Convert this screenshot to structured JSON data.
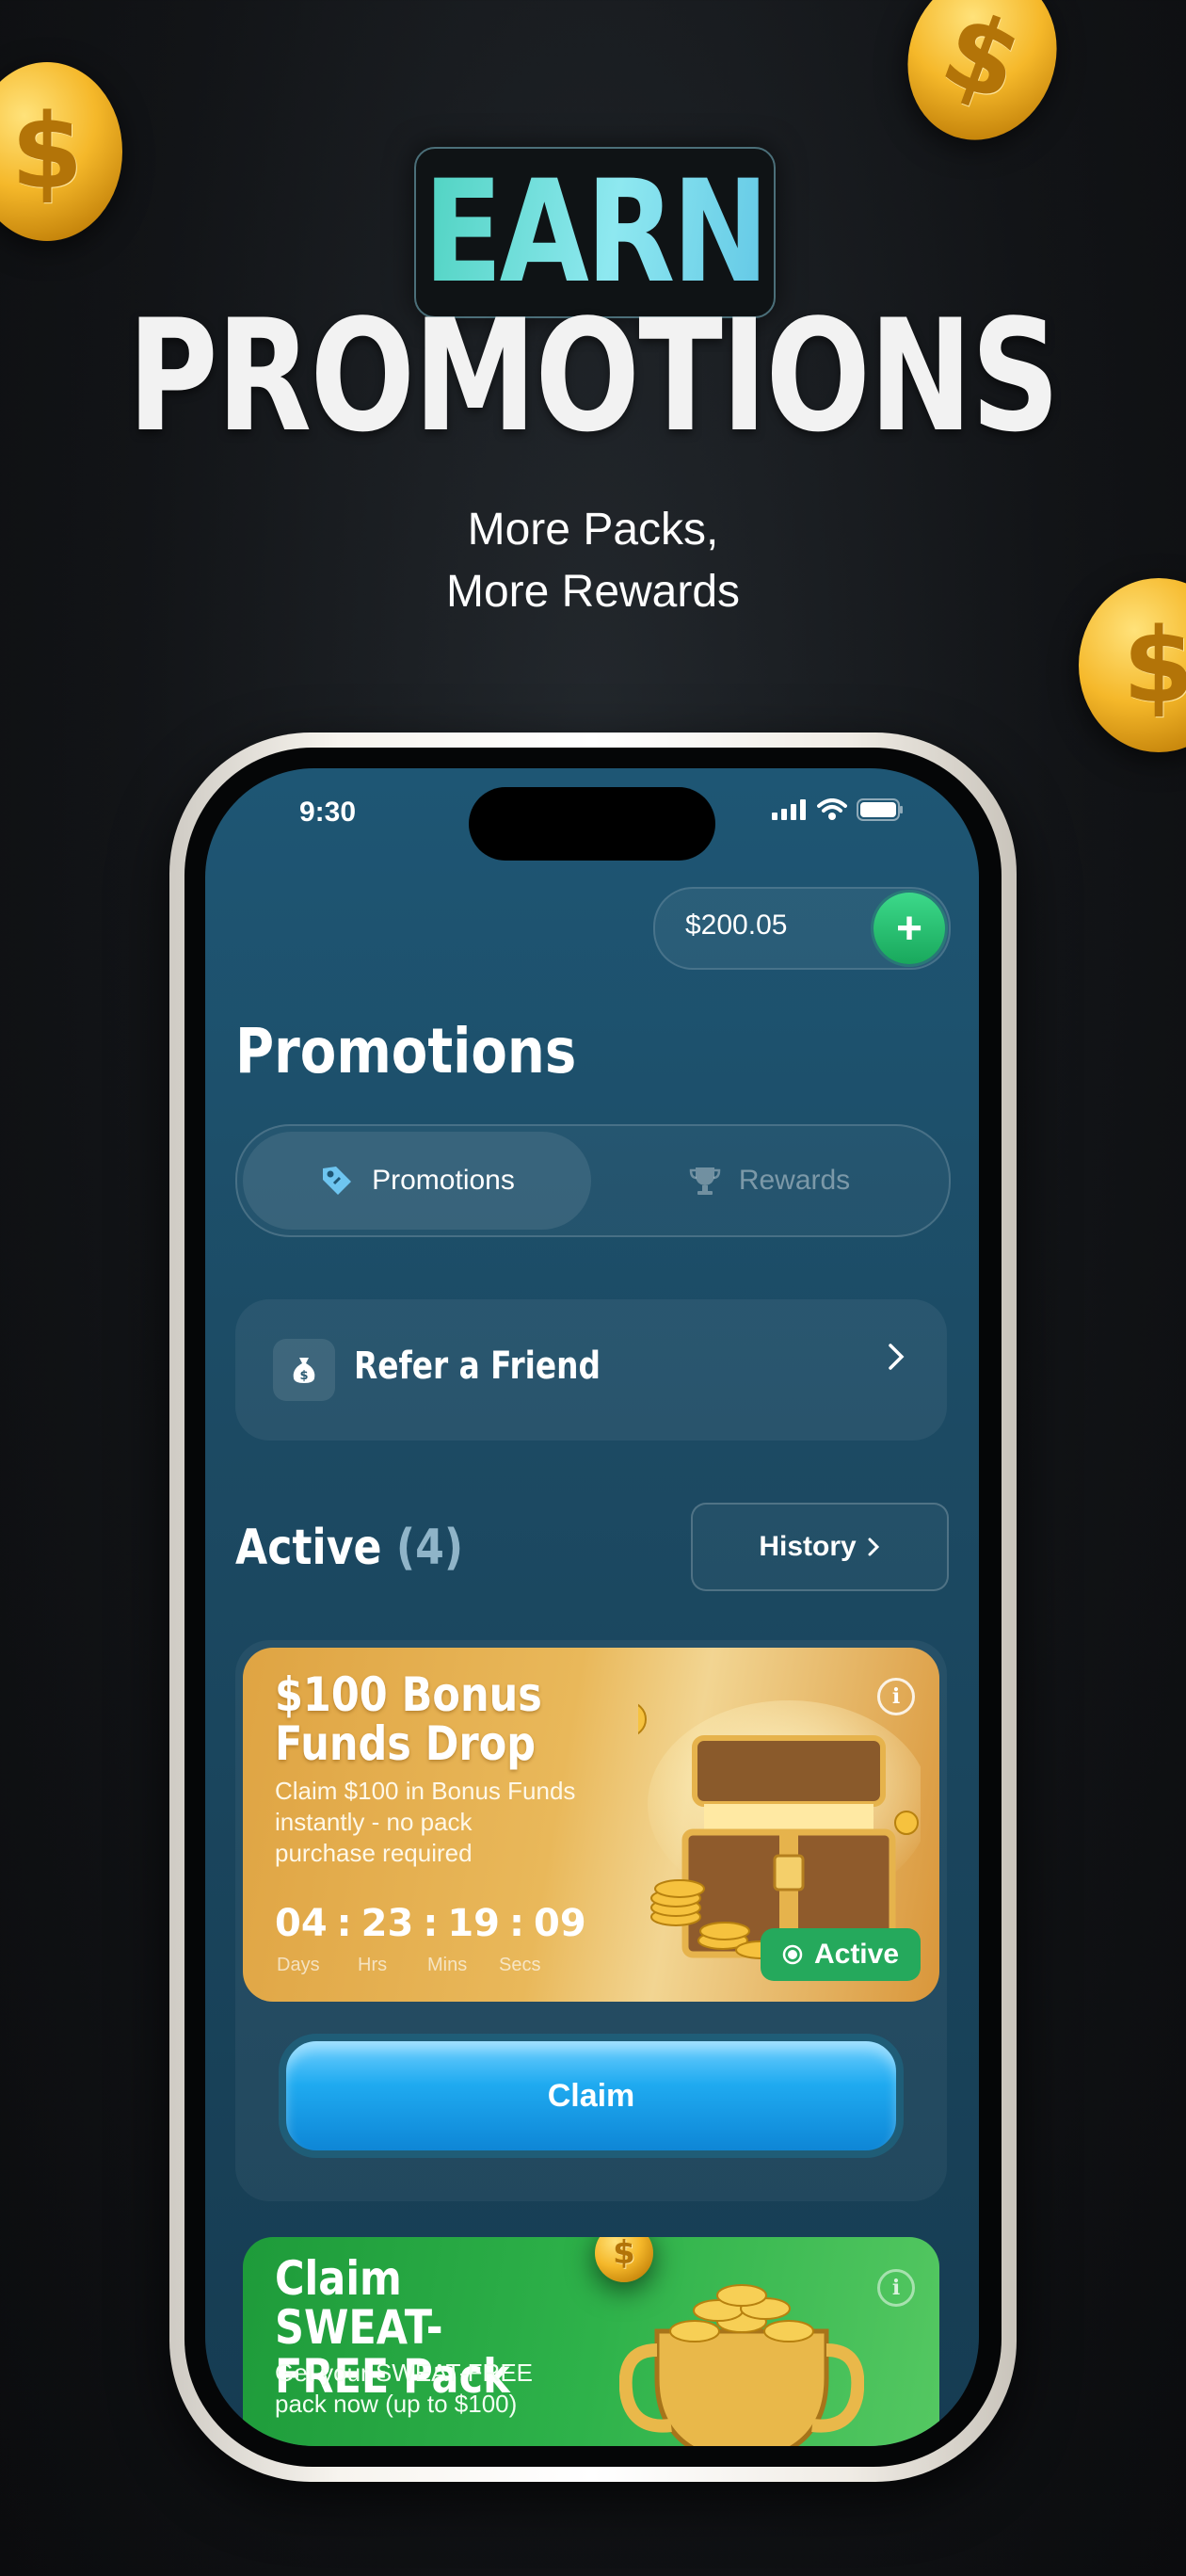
{
  "hero": {
    "earn": "EARN",
    "title": "PROMOTIONS",
    "subtitle_line1": "More Packs,",
    "subtitle_line2": "More Rewards"
  },
  "status_bar": {
    "time": "9:30"
  },
  "wallet": {
    "balance": "$200.05",
    "add_symbol": "+"
  },
  "page": {
    "title": "Promotions"
  },
  "tabs": [
    {
      "label": "Promotions",
      "icon": "tag-icon",
      "selected": true
    },
    {
      "label": "Rewards",
      "icon": "trophy-icon",
      "selected": false
    }
  ],
  "refer": {
    "label": "Refer a Friend",
    "icon": "money-bag-icon"
  },
  "active_section": {
    "title": "Active",
    "count": "(4)",
    "history_label": "History"
  },
  "promos": [
    {
      "title": "$100 Bonus Funds Drop",
      "description": "Claim $100 in Bonus Funds instantly - no pack purchase required",
      "timer": {
        "days": "04",
        "hours": "23",
        "mins": "19",
        "secs": "09"
      },
      "timer_labels": {
        "days": "Days",
        "hours": "Hrs",
        "mins": "Mins",
        "secs": "Secs"
      },
      "status": "Active",
      "cta": "Claim",
      "color": "#e3a848"
    },
    {
      "title": "Claim SWEAT-FREE Pack",
      "description": "Get your SWEAT-FREE pack now (up to $100)",
      "color": "#2eb24a"
    }
  ],
  "colors": {
    "accent_green": "#25a95c",
    "claim_blue": "#1faaf0",
    "screen_bg": "#1e5674"
  }
}
